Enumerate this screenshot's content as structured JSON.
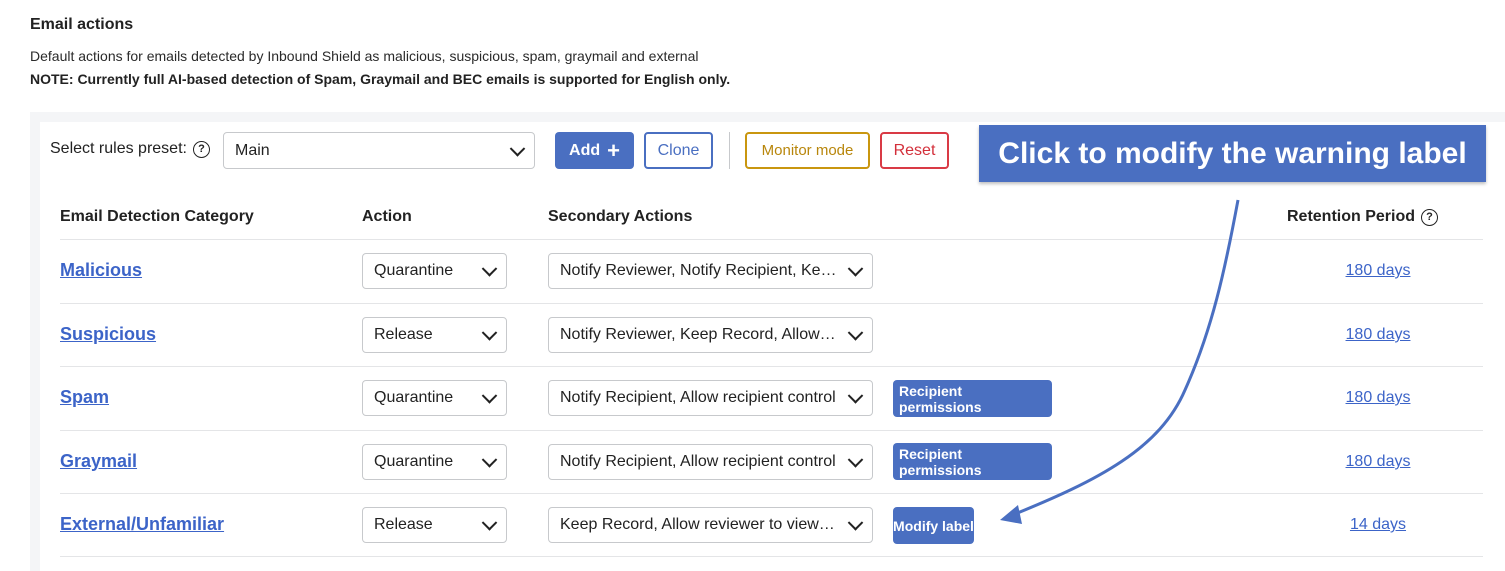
{
  "header": {
    "title": "Email actions",
    "description": "Default actions for emails detected by Inbound Shield as malicious, suspicious, spam, graymail and external",
    "note": "NOTE: Currently full AI-based detection of Spam, Graymail and BEC emails is supported for English only."
  },
  "toolbar": {
    "preset_label": "Select rules preset:",
    "preset_value": "Main",
    "add_label": "Add",
    "clone_label": "Clone",
    "monitor_label": "Monitor mode",
    "reset_label": "Reset"
  },
  "callout": {
    "text": "Click to modify the warning label"
  },
  "table": {
    "columns": [
      "Email Detection Category",
      "Action",
      "Secondary Actions",
      "Retention Period"
    ],
    "rows": [
      {
        "category": "Malicious",
        "action": "Quarantine",
        "secondary": "Notify Reviewer, Notify Recipient, Keep Record",
        "extra_button": "",
        "retention": "180 days"
      },
      {
        "category": "Suspicious",
        "action": "Release",
        "secondary": "Notify Reviewer, Keep Record, Allow reviewer to view",
        "extra_button": "",
        "retention": "180 days"
      },
      {
        "category": "Spam",
        "action": "Quarantine",
        "secondary": "Notify Recipient, Allow recipient control",
        "extra_button": "Recipient permissions",
        "retention": "180 days"
      },
      {
        "category": "Graymail",
        "action": "Quarantine",
        "secondary": "Notify Recipient, Allow recipient control",
        "extra_button": "Recipient permissions",
        "retention": "180 days"
      },
      {
        "category": "External/Unfamiliar",
        "action": "Release",
        "secondary": "Keep Record, Allow reviewer to view content",
        "extra_button": "Modify label",
        "retention": "14 days"
      }
    ]
  },
  "colors": {
    "accent": "#4a6fc1",
    "link": "#3c64c8",
    "monitor": "#c9960f",
    "reset": "#d93a45"
  }
}
